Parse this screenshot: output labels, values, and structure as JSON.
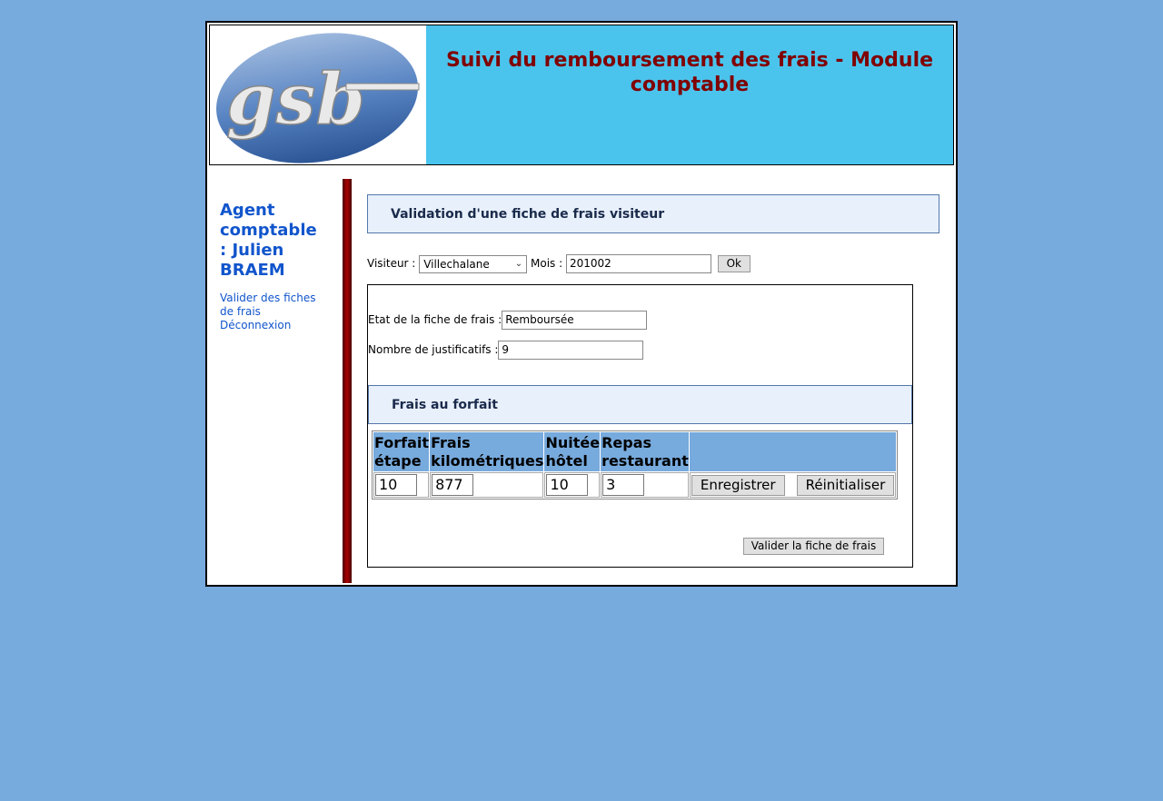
{
  "header": {
    "logo_text": "gsb",
    "title": "Suivi du remboursement des frais - Module comptable"
  },
  "sidebar": {
    "agent_title": "Agent comptable : Julien BRAEM",
    "links": [
      "Valider des fiches de frais",
      "Déconnexion"
    ]
  },
  "validation": {
    "heading": "Validation d'une fiche de frais visiteur",
    "visiteur_label": "Visiteur :",
    "visiteur_value": "Villechalane",
    "mois_label": "Mois :",
    "mois_value": "201002",
    "ok_label": "Ok"
  },
  "fiche": {
    "etat_label": "Etat de la fiche de frais :",
    "etat_value": "Remboursée",
    "nb_label": "Nombre de justificatifs :",
    "nb_value": "9",
    "forfait_heading": "Frais au forfait",
    "columns": [
      "Forfait étape",
      "Frais kilométriques",
      "Nuitée hôtel",
      "Repas restaurant"
    ],
    "values": [
      "10",
      "877",
      "10",
      "3"
    ],
    "save_label": "Enregistrer",
    "reset_label": "Réinitialiser",
    "valider_label": "Valider la fiche de frais"
  },
  "colors": {
    "background": "#77aadd",
    "header_bg": "#4ac4ed",
    "title": "#800000",
    "link": "#1155cc",
    "section_bg": "#e8f0fc"
  }
}
